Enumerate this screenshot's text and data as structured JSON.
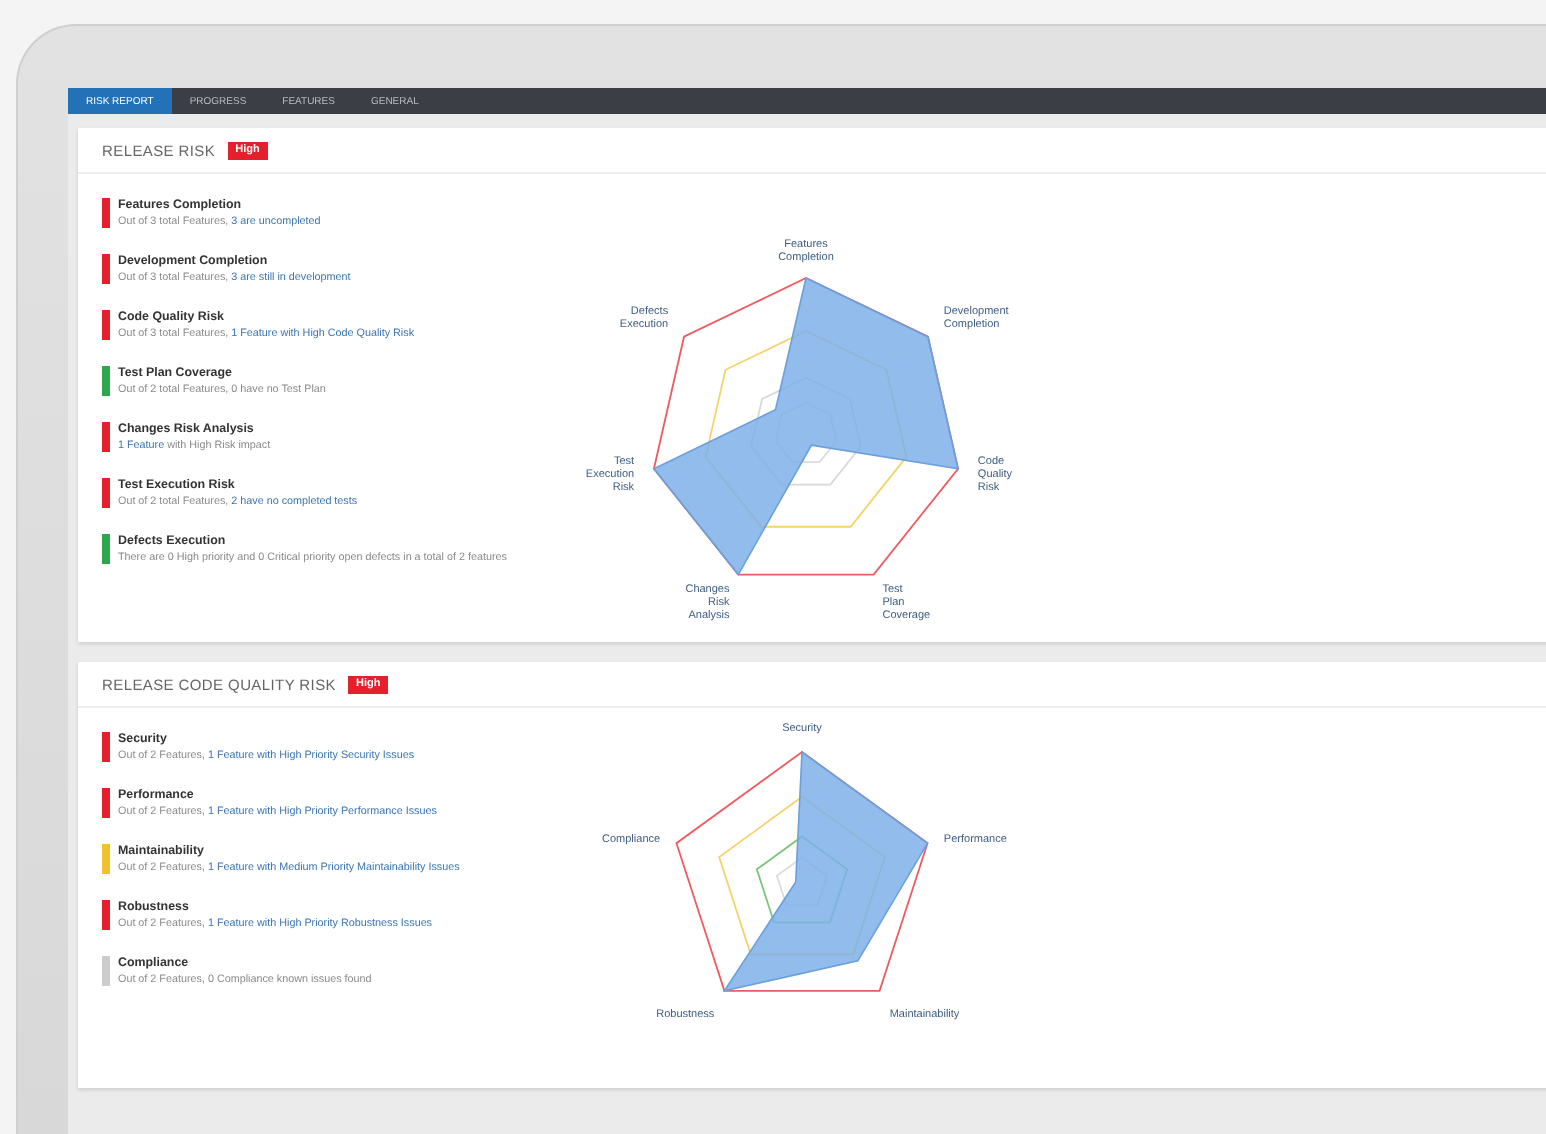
{
  "tabs": [
    {
      "label": "RISK REPORT",
      "selected": true
    },
    {
      "label": "PROGRESS",
      "selected": false
    },
    {
      "label": "FEATURES",
      "selected": false
    },
    {
      "label": "GENERAL",
      "selected": false
    }
  ],
  "panels": [
    {
      "title": "RELEASE RISK",
      "badge": "High",
      "items": [
        {
          "name": "Features Completion",
          "color": "#e3202b",
          "detail": [
            {
              "text": "Out of 3 total Features, ",
              "link": false
            },
            {
              "text": "3 are uncompleted",
              "link": true
            }
          ]
        },
        {
          "name": "Development Completion",
          "color": "#e3202b",
          "detail": [
            {
              "text": "Out of 3 total Features, ",
              "link": false
            },
            {
              "text": "3 are still in development",
              "link": true
            }
          ]
        },
        {
          "name": "Code Quality Risk",
          "color": "#e3202b",
          "detail": [
            {
              "text": "Out of 3 total Features, ",
              "link": false
            },
            {
              "text": "1 Feature with High Code Quality Risk",
              "link": true
            }
          ]
        },
        {
          "name": "Test Plan Coverage",
          "color": "#2ea64b",
          "detail": [
            {
              "text": "Out of 2 total Features, 0 have no Test Plan",
              "link": false
            }
          ]
        },
        {
          "name": "Changes Risk Analysis",
          "color": "#e3202b",
          "detail": [
            {
              "text": "1 Feature",
              "link": true
            },
            {
              "text": " with High Risk impact",
              "link": false
            }
          ]
        },
        {
          "name": "Test Execution Risk",
          "color": "#e3202b",
          "detail": [
            {
              "text": "Out of 2 total Features, ",
              "link": false
            },
            {
              "text": "2 have no completed tests",
              "link": true
            }
          ]
        },
        {
          "name": "Defects Execution",
          "color": "#2ea64b",
          "detail": [
            {
              "text": "There are 0 High priority and 0 Critical priority open defects in a total of 2 features",
              "link": false
            }
          ]
        }
      ],
      "axes": [
        "Features Completion",
        "Defects Execution",
        "Development Completion",
        "Test Execution Risk",
        "Code Quality Risk",
        "Changes Risk Analysis",
        "Test Plan Coverage"
      ]
    },
    {
      "title": "RELEASE CODE QUALITY RISK",
      "badge": "High",
      "items": [
        {
          "name": "Security",
          "color": "#e3202b",
          "detail": [
            {
              "text": "Out of 2 Features, ",
              "link": false
            },
            {
              "text": "1 Feature with High Priority Security Issues",
              "link": true
            }
          ]
        },
        {
          "name": "Performance",
          "color": "#e3202b",
          "detail": [
            {
              "text": "Out of 2 Features, ",
              "link": false
            },
            {
              "text": "1 Feature with High Priority Performance Issues",
              "link": true
            }
          ]
        },
        {
          "name": "Maintainability",
          "color": "#f2c12e",
          "detail": [
            {
              "text": "Out of 2 Features, ",
              "link": false
            },
            {
              "text": "1 Feature with Medium Priority Maintainability Issues",
              "link": true
            }
          ]
        },
        {
          "name": "Robustness",
          "color": "#e3202b",
          "detail": [
            {
              "text": "Out of 2 Features, ",
              "link": false
            },
            {
              "text": "1 Feature with High Priority Robustness Issues",
              "link": true
            }
          ]
        },
        {
          "name": "Compliance",
          "color": "#cccccc",
          "detail": [
            {
              "text": "Out of 2 Features, 0 Compliance known issues found",
              "link": false
            }
          ]
        }
      ],
      "axes": [
        "Security",
        "Compliance",
        "Performance",
        "Robustness",
        "Maintainability"
      ]
    }
  ]
}
